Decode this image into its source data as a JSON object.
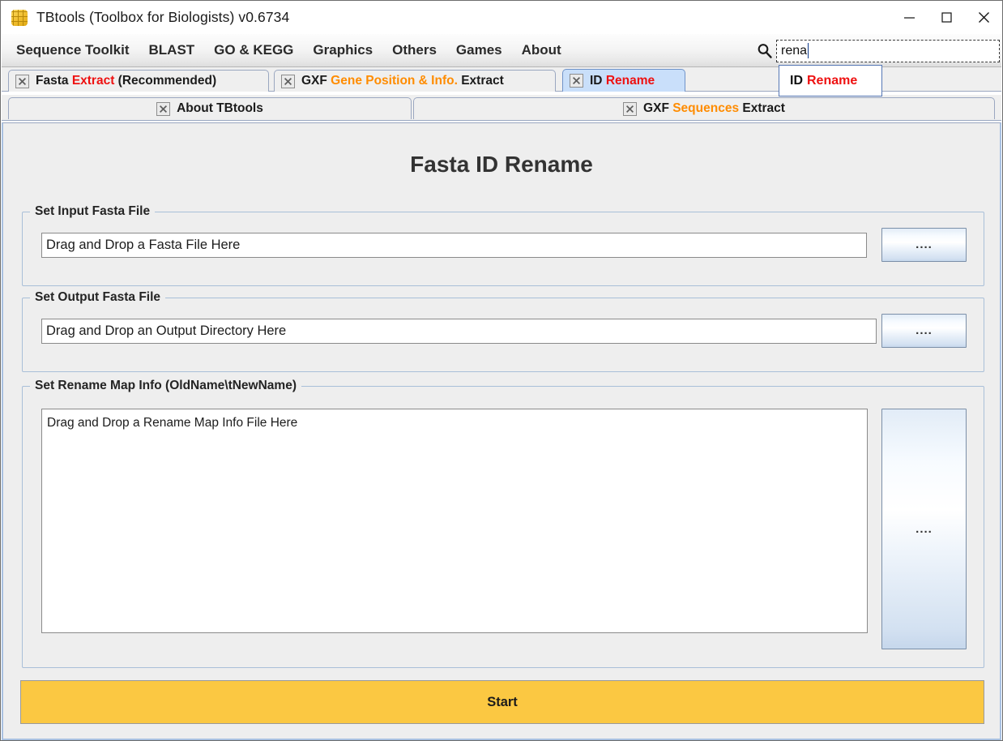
{
  "window": {
    "title": "TBtools (Toolbox for Biologists) v0.6734",
    "icon": "tbtools-grid-icon",
    "controls": {
      "minimize": "minimize-icon",
      "maximize": "maximize-icon",
      "close": "close-icon"
    }
  },
  "menubar": {
    "items": [
      {
        "label": "Sequence Toolkit"
      },
      {
        "label": "BLAST"
      },
      {
        "label": "GO & KEGG"
      },
      {
        "label": "Graphics"
      },
      {
        "label": "Others"
      },
      {
        "label": "Games"
      },
      {
        "label": "About"
      }
    ],
    "search": {
      "icon": "search-icon",
      "value": "rena",
      "placeholder": ""
    },
    "suggestion": {
      "prefix": "ID",
      "match": "Rename"
    }
  },
  "tabs": {
    "row1": [
      {
        "close_icon": "close-tab-icon",
        "parts": [
          {
            "text": "Fasta ",
            "color": "black"
          },
          {
            "text": "Extract",
            "color": "red"
          },
          {
            "text": " (Recommended)",
            "color": "black"
          }
        ],
        "active": false
      },
      {
        "close_icon": "close-tab-icon",
        "parts": [
          {
            "text": "GXF ",
            "color": "black"
          },
          {
            "text": "Gene Position & Info.",
            "color": "orange"
          },
          {
            "text": " Extract",
            "color": "black"
          }
        ],
        "active": false
      },
      {
        "close_icon": "close-tab-icon",
        "parts": [
          {
            "text": "ID ",
            "color": "black"
          },
          {
            "text": "Rename",
            "color": "red"
          }
        ],
        "active": true
      }
    ],
    "row2": [
      {
        "close_icon": "close-tab-icon",
        "parts": [
          {
            "text": "About TBtools",
            "color": "black"
          }
        ],
        "active": false
      },
      {
        "close_icon": "close-tab-icon",
        "parts": [
          {
            "text": "GXF ",
            "color": "black"
          },
          {
            "text": "Sequences",
            "color": "orange"
          },
          {
            "text": " Extract",
            "color": "black"
          }
        ],
        "active": false
      }
    ]
  },
  "main": {
    "page_title": "Fasta ID Rename",
    "input_group": {
      "title": "Set Input Fasta File",
      "field_value": "Drag and Drop a Fasta File Here",
      "browse_label": "...."
    },
    "output_group": {
      "title": "Set Output Fasta File",
      "field_value": "Drag and Drop an Output Directory Here",
      "browse_label": "...."
    },
    "map_group": {
      "title": "Set Rename Map Info (OldName\\tNewName)",
      "textarea_value": "Drag and Drop a Rename Map Info File Here",
      "browse_label": "...."
    },
    "start_button": {
      "label": "Start",
      "color": "#fbc842"
    }
  },
  "colors": {
    "accent_yellow": "#fbc842",
    "tab_active_blue": "#c9dffa",
    "highlight_red": "#ee1111",
    "highlight_orange": "#ff8c00",
    "panel_bg": "#eeeeee"
  }
}
